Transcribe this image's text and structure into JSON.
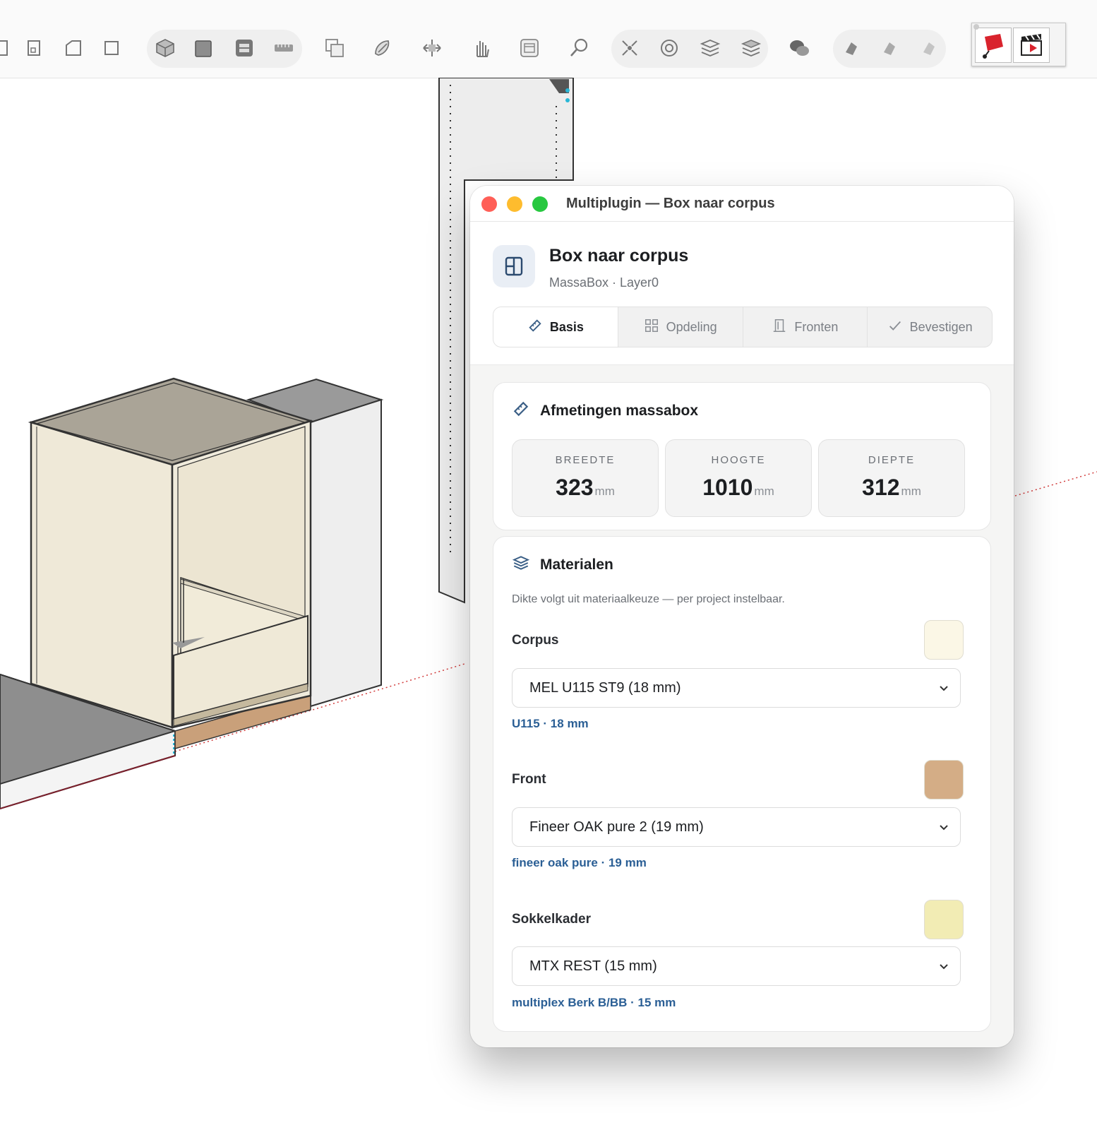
{
  "toolbar": {
    "icons": [
      "page-icon",
      "file-icon",
      "shape-icon",
      "square-icon",
      "box-3d-icon",
      "solid-cube-icon",
      "section-icon",
      "tape-icon",
      "copy-icon",
      "paint-icon",
      "move-icon",
      "hand-icon",
      "frame-icon",
      "search-icon",
      "explode-icon",
      "target-icon",
      "layers-cross-icon",
      "layers-icon",
      "chat-icon",
      "fill-1-icon",
      "fill-2-icon",
      "fill-3-icon"
    ]
  },
  "extensions": {
    "items": [
      "paint-eraser-icon",
      "clapper-icon"
    ]
  },
  "window": {
    "title": "Multiplugin — Box naar corpus",
    "header": {
      "title": "Box naar corpus",
      "subtitle": "MassaBox · Layer0"
    },
    "tabs": [
      {
        "label": "Basis",
        "icon": "ruler-icon",
        "active": true
      },
      {
        "label": "Opdeling",
        "icon": "grid-icon",
        "active": false
      },
      {
        "label": "Fronten",
        "icon": "door-icon",
        "active": false
      },
      {
        "label": "Bevestigen",
        "icon": "check-icon",
        "active": false
      }
    ],
    "dimensions": {
      "title": "Afmetingen massabox",
      "unit": "mm",
      "items": [
        {
          "label": "BREEDTE",
          "value": "323"
        },
        {
          "label": "HOOGTE",
          "value": "1010"
        },
        {
          "label": "DIEPTE",
          "value": "312"
        }
      ]
    },
    "materials": {
      "title": "Materialen",
      "hint": "Dikte volgt uit materiaalkeuze — per project instelbaar.",
      "items": [
        {
          "label": "Corpus",
          "selected": "MEL U115 ST9 (18 mm)",
          "note": "U115 · 18 mm",
          "swatch": "#fbf7e6"
        },
        {
          "label": "Front",
          "selected": "Fineer OAK pure 2 (19 mm)",
          "note": "fineer oak pure · 19 mm",
          "swatch": "#d4ad86"
        },
        {
          "label": "Sokkelkader",
          "selected": "MTX REST (15 mm)",
          "note": "multiplex Berk B/BB · 15 mm",
          "swatch": "#f2ecb4"
        }
      ]
    }
  },
  "colors": {
    "accent_link": "#2b5f95",
    "close": "#ff5f57",
    "minimize": "#febc2e",
    "zoom": "#28c840"
  }
}
